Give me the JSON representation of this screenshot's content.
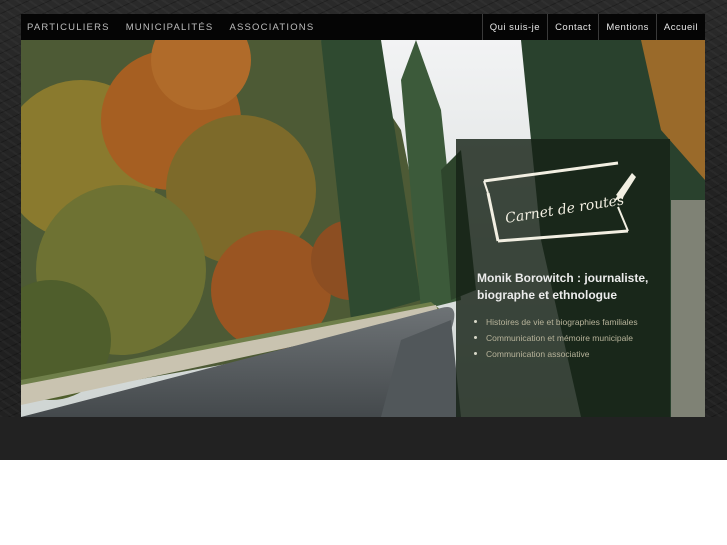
{
  "nav": {
    "left_items": [
      "PARTICULIERS",
      "MUNICIPALITÉS",
      "ASSOCIATIONS"
    ],
    "right_items": [
      "Qui suis-je",
      "Contact",
      "Mentions",
      "Accueil"
    ]
  },
  "logo": {
    "text": "Carnet de routes"
  },
  "intro": {
    "author_title": "Monik Borowitch : journaliste, biographe et ethnologue",
    "services": [
      "Histoires de vie et biographies familiales",
      "Communication et mémoire municipale",
      "Communication associative"
    ]
  },
  "icons": {
    "logo_pen": "pen-nib-icon"
  },
  "colors": {
    "nav_bg": "#050505",
    "overlay_bg": "#162216",
    "service_text": "#b7b39a"
  }
}
